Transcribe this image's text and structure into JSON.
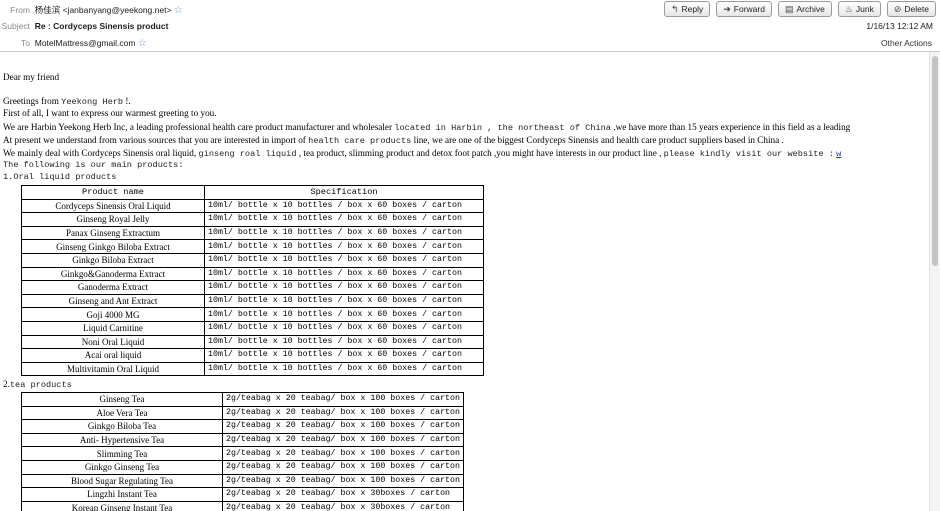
{
  "header": {
    "from_label": "From",
    "from_value": "杨佳滨 <janbanyang@yeekong.net>",
    "subject_label": "Subject",
    "subject_value": "Re : Cordyceps Sinensis product",
    "to_label": "To",
    "to_value": "MotelMattress@gmail.com",
    "date": "1/16/13 12:12 AM",
    "other_actions": "Other Actions",
    "star_icon": "star-icon"
  },
  "toolbar": {
    "reply": "Reply",
    "forward": "Forward",
    "archive": "Archive",
    "junk": "Junk",
    "delete": "Delete"
  },
  "body": {
    "greeting": "Dear my friend",
    "greetings_from": "Greetings from",
    "greetings_company": "Yeekong Herb",
    "greetings_end": "!.",
    "line_first": "First of all, I want to express our warmest greeting to you.",
    "line_harbin_1": "We are Harbin Yeekong Herb Inc, a leading professional health care product manufacturer and wholesaler",
    "line_harbin_2": "located in Harbin , the northeast of China",
    "line_harbin_3": ".we have more than 15 years experience in this field as a leading",
    "line_present_1": "At present we understand from various sources that you are interested in import of",
    "line_present_2": "health care products",
    "line_present_3": "line,  we are one of the biggest Cordyceps Sinensis and health care product suppliers based in China .",
    "line_deal_1": "We mainly deal with Cordyceps Sinensis oral liquid,",
    "line_deal_2": "ginseng roal liquid",
    "line_deal_3": ", tea product, slimming product and detox foot patch ,you might have interests in our product line ,",
    "line_deal_4": "please kindly visit our website :",
    "line_deal_link": "w",
    "line_following": "The following is our main products:",
    "section1": "1.Oral liquid products",
    "section2_num": "2.",
    "section2_title": "tea products"
  },
  "oral_table": {
    "headers": [
      "Product name",
      "Specification"
    ],
    "rows": [
      [
        "Cordyceps Sinensis Oral Liquid",
        "10ml/ bottle x 10 bottles / box x 60 boxes / carton"
      ],
      [
        "Ginseng Royal Jelly",
        "10ml/ bottle x 10 bottles / box x 60 boxes / carton"
      ],
      [
        "Panax Ginseng Extractum",
        "10ml/ bottle x 10 bottles / box x 60 boxes / carton"
      ],
      [
        "Ginseng Ginkgo Biloba Extract",
        "10ml/ bottle x 10 bottles / box x 60 boxes / carton"
      ],
      [
        "Ginkgo Biloba Extract",
        "10ml/ bottle x 10 bottles / box x 60 boxes / carton"
      ],
      [
        "Ginkgo&Ganoderma Extract",
        "10ml/ bottle x 10 bottles / box x 60 boxes / carton"
      ],
      [
        "Ganoderma Extract",
        "10ml/ bottle x 10 bottles / box x 60 boxes / carton"
      ],
      [
        "Ginseng and Ant Extract",
        "10ml/ bottle x 10 bottles / box x 60 boxes / carton"
      ],
      [
        "Goji 4000 MG",
        "10ml/ bottle x 10 bottles / box x 60 boxes / carton"
      ],
      [
        "Liquid Carnitine",
        "10ml/ bottle x 10 bottles / box x 60 boxes / carton"
      ],
      [
        "Noni Oral Liquid",
        "10ml/ bottle x 10 bottles / box x 60 boxes / carton"
      ],
      [
        "Acai oral liquid",
        "10ml/ bottle x 10 bottles / box x 60 boxes / carton"
      ],
      [
        "Multivitamin Oral Liquid",
        "10ml/ bottle x 10 bottles / box x 60 boxes / carton"
      ]
    ]
  },
  "tea_table": {
    "rows": [
      [
        "Ginseng Tea",
        "2g/teabag x 20 teabag/ box x 100 boxes / carton"
      ],
      [
        "Aloe Vera Tea",
        "2g/teabag x 20 teabag/ box x 100 boxes / carton"
      ],
      [
        "Ginkgo Biloba Tea",
        "2g/teabag x 20 teabag/ box x 100 boxes / carton"
      ],
      [
        "Anti- Hypertensive Tea",
        "2g/teabag x 20 teabag/ box x 100 boxes / carton"
      ],
      [
        "Slimming  Tea",
        "2g/teabag x 20 teabag/ box x 100 boxes / carton"
      ],
      [
        "Ginkgo Ginseng Tea",
        "2g/teabag x 20 teabag/ box x 100 boxes / carton"
      ],
      [
        "Blood Sugar Regulating Tea",
        "2g/teabag x 20 teabag/ box x 100 boxes / carton"
      ],
      [
        "Lingzhi Instant Tea",
        "2g/teabag x 20 teabag/ box x 30boxes / carton"
      ],
      [
        "Korean Ginseng Instant Tea",
        "2g/teabag x 20 teabag/ box x 30boxes / carton"
      ]
    ]
  }
}
